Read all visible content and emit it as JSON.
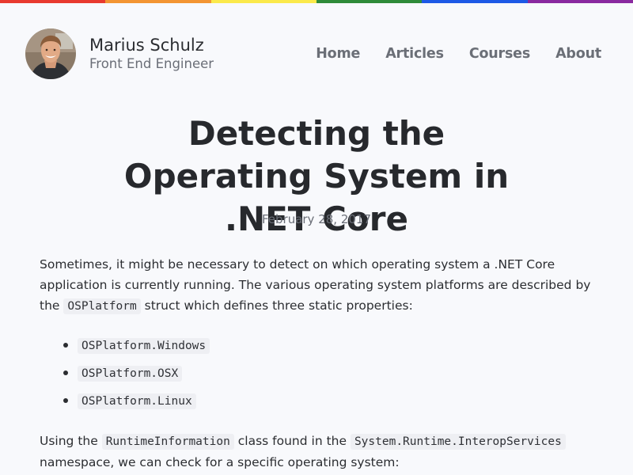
{
  "rainbow_colors": [
    "#e83a2f",
    "#f39533",
    "#fbe94b",
    "#2f8b3a",
    "#1d59e6",
    "#8a2aa0"
  ],
  "site": {
    "author_name": "Marius Schulz",
    "author_tagline": "Front End Engineer",
    "avatar_icon": "avatar-photo"
  },
  "nav": {
    "items": [
      {
        "label": "Home"
      },
      {
        "label": "Articles"
      },
      {
        "label": "Courses"
      },
      {
        "label": "About"
      }
    ]
  },
  "article": {
    "title": "Detecting the Operating System in .NET Core",
    "date": "February 28, 2017",
    "intro": {
      "text1": "Sometimes, it might be necessary to detect on which operating system a .NET Core application is currently running. The various operating system platforms are described by the ",
      "code1": "OSPlatform",
      "text2": " struct which defines three static properties:"
    },
    "platforms": [
      {
        "code": "OSPlatform.Windows"
      },
      {
        "code": "OSPlatform.OSX"
      },
      {
        "code": "OSPlatform.Linux"
      }
    ],
    "usage": {
      "text1": "Using the ",
      "code1": "RuntimeInformation",
      "text2": " class found in the ",
      "code2": "System.Runtime.InteropServices",
      "text3": " namespace, we can check for a specific operating system:"
    }
  }
}
